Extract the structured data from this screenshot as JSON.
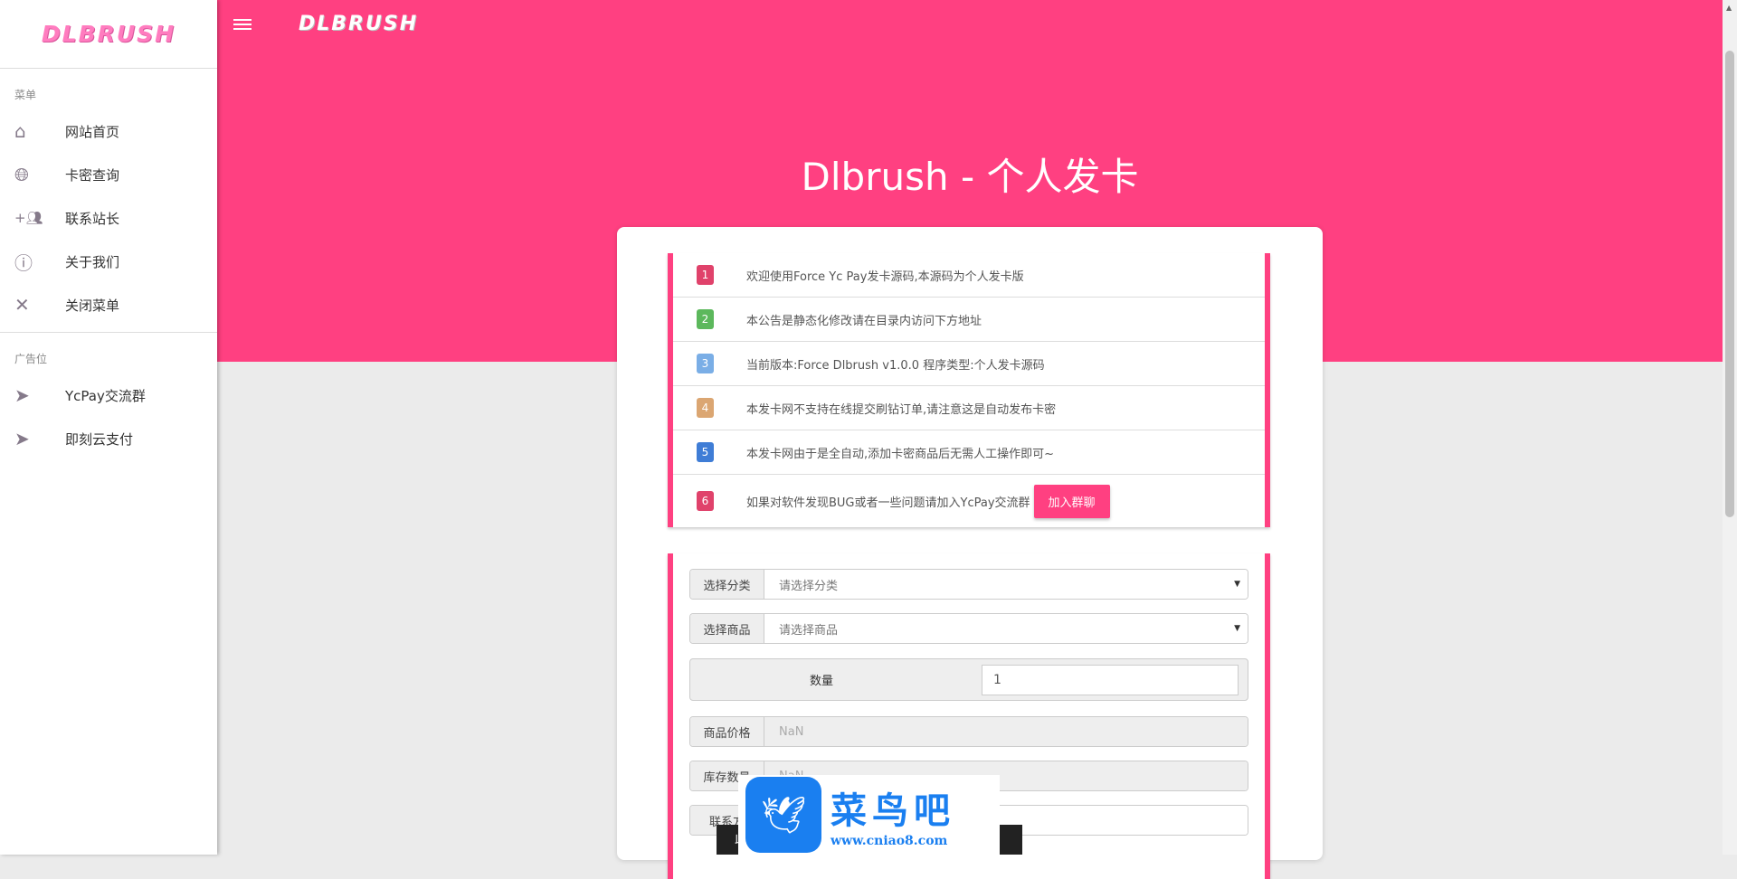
{
  "sidebar": {
    "logo": "DLBRUSH",
    "menu_label": "菜单",
    "items": [
      {
        "label": "网站首页",
        "icon": "home-icon"
      },
      {
        "label": "卡密查询",
        "icon": "globe-icon"
      },
      {
        "label": "联系站长",
        "icon": "group-add-icon"
      },
      {
        "label": "关于我们",
        "icon": "info-icon"
      },
      {
        "label": "关闭菜单",
        "icon": "close-icon"
      }
    ],
    "ads_label": "广告位",
    "ads": [
      {
        "label": "YcPay交流群",
        "icon": "send-icon"
      },
      {
        "label": "即刻云支付",
        "icon": "send-icon"
      }
    ]
  },
  "header": {
    "logo": "DLBRUSH",
    "title": "Dlbrush - 个人发卡",
    "accent": "#ff4081"
  },
  "notice": [
    {
      "n": "1",
      "color": "#e0426b",
      "text": "欢迎使用Force Yc Pay发卡源码,本源码为个人发卡版"
    },
    {
      "n": "2",
      "color": "#5cb85c",
      "text": "本公告是静态化修改请在目录内访问下方地址"
    },
    {
      "n": "3",
      "color": "#7aaee6",
      "text": "当前版本:Force Dlbrush v1.0.0 程序类型:个人发卡源码"
    },
    {
      "n": "4",
      "color": "#dba672",
      "text": "本发卡网不支持在线提交刷钻订单,请注意这是自动发布卡密"
    },
    {
      "n": "5",
      "color": "#3f7dd6",
      "text": "本发卡网由于是全自动,添加卡密商品后无需人工操作即可~"
    },
    {
      "n": "6",
      "color": "#e0426b",
      "text": "如果对软件发现BUG或者一些问题请加入YcPay交流群"
    }
  ],
  "join_button": "加入群聊",
  "form": {
    "category_label": "选择分类",
    "category_value": "请选择分类",
    "product_label": "选择商品",
    "product_value": "请选择商品",
    "qty_label": "数量",
    "qty_value": "1",
    "price_label": "商品价格",
    "price_value": "NaN",
    "stock_label": "库存数量",
    "stock_value": "NaN",
    "contact_label": "联系方",
    "submit_partial": "此"
  },
  "watermark": {
    "cn": "菜鸟吧",
    "url": "www.cniao8.com"
  }
}
